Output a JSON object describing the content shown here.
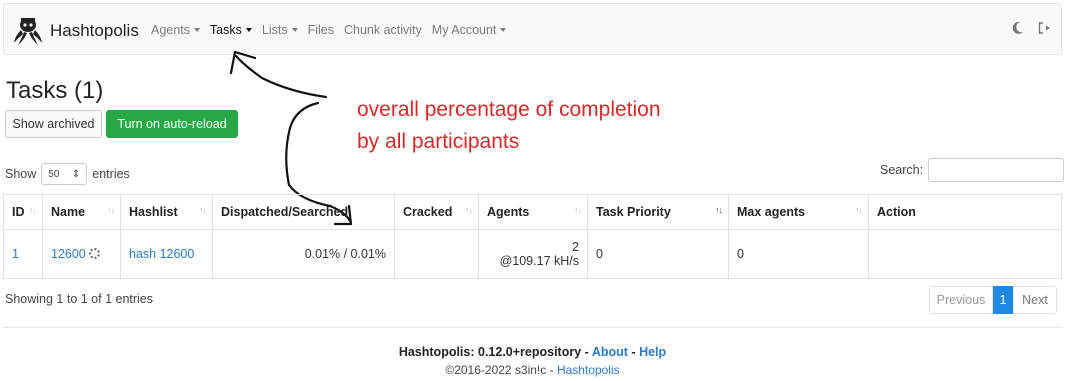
{
  "app": {
    "brand": "Hashtopolis"
  },
  "nav": {
    "items": [
      {
        "label": "Agents",
        "dropdown": true,
        "active": false
      },
      {
        "label": "Tasks",
        "dropdown": true,
        "active": true
      },
      {
        "label": "Lists",
        "dropdown": true,
        "active": false
      },
      {
        "label": "Files",
        "dropdown": false,
        "active": false
      },
      {
        "label": "Chunk activity",
        "dropdown": false,
        "active": false
      },
      {
        "label": "My Account",
        "dropdown": true,
        "active": false
      }
    ],
    "right_icons": [
      "moon-icon",
      "logout-icon"
    ]
  },
  "page": {
    "title": "Tasks (1)",
    "show_archived_label": "Show archived",
    "auto_reload_label": "Turn on auto-reload"
  },
  "annotation": {
    "line1": "overall percentage of completion",
    "line2": "by all participants",
    "color": "#d42a2a"
  },
  "table_controls": {
    "show_label": "Show",
    "entries_value": "50",
    "entries_label": "entries",
    "search_label": "Search:",
    "search_value": ""
  },
  "table": {
    "columns": [
      "ID",
      "Name",
      "Hashlist",
      "Dispatched/Searched",
      "Cracked",
      "Agents",
      "Task Priority",
      "Max agents",
      "Action"
    ],
    "rows": [
      {
        "id": "1",
        "name": "12600",
        "hashlist": "hash 12600",
        "dispatched_searched": "0.01% / 0.01%",
        "cracked": "",
        "agents_count": "2",
        "agents_speed": "@109.17 kH/s",
        "task_priority": "0",
        "max_agents": "0",
        "action": ""
      }
    ]
  },
  "pagination": {
    "showing": "Showing 1 to 1 of 1 entries",
    "previous": "Previous",
    "current_page": "1",
    "next": "Next"
  },
  "footer": {
    "version": "Hashtopolis: 0.12.0+repository",
    "sep": " - ",
    "about": "About",
    "help": "Help",
    "copyright": "©2016-2022 s3in!c - ",
    "copyright_link": "Hashtopolis"
  },
  "colors": {
    "accent": "#28a745",
    "link": "#2a7ac7",
    "page_active": "#1e88e5"
  }
}
